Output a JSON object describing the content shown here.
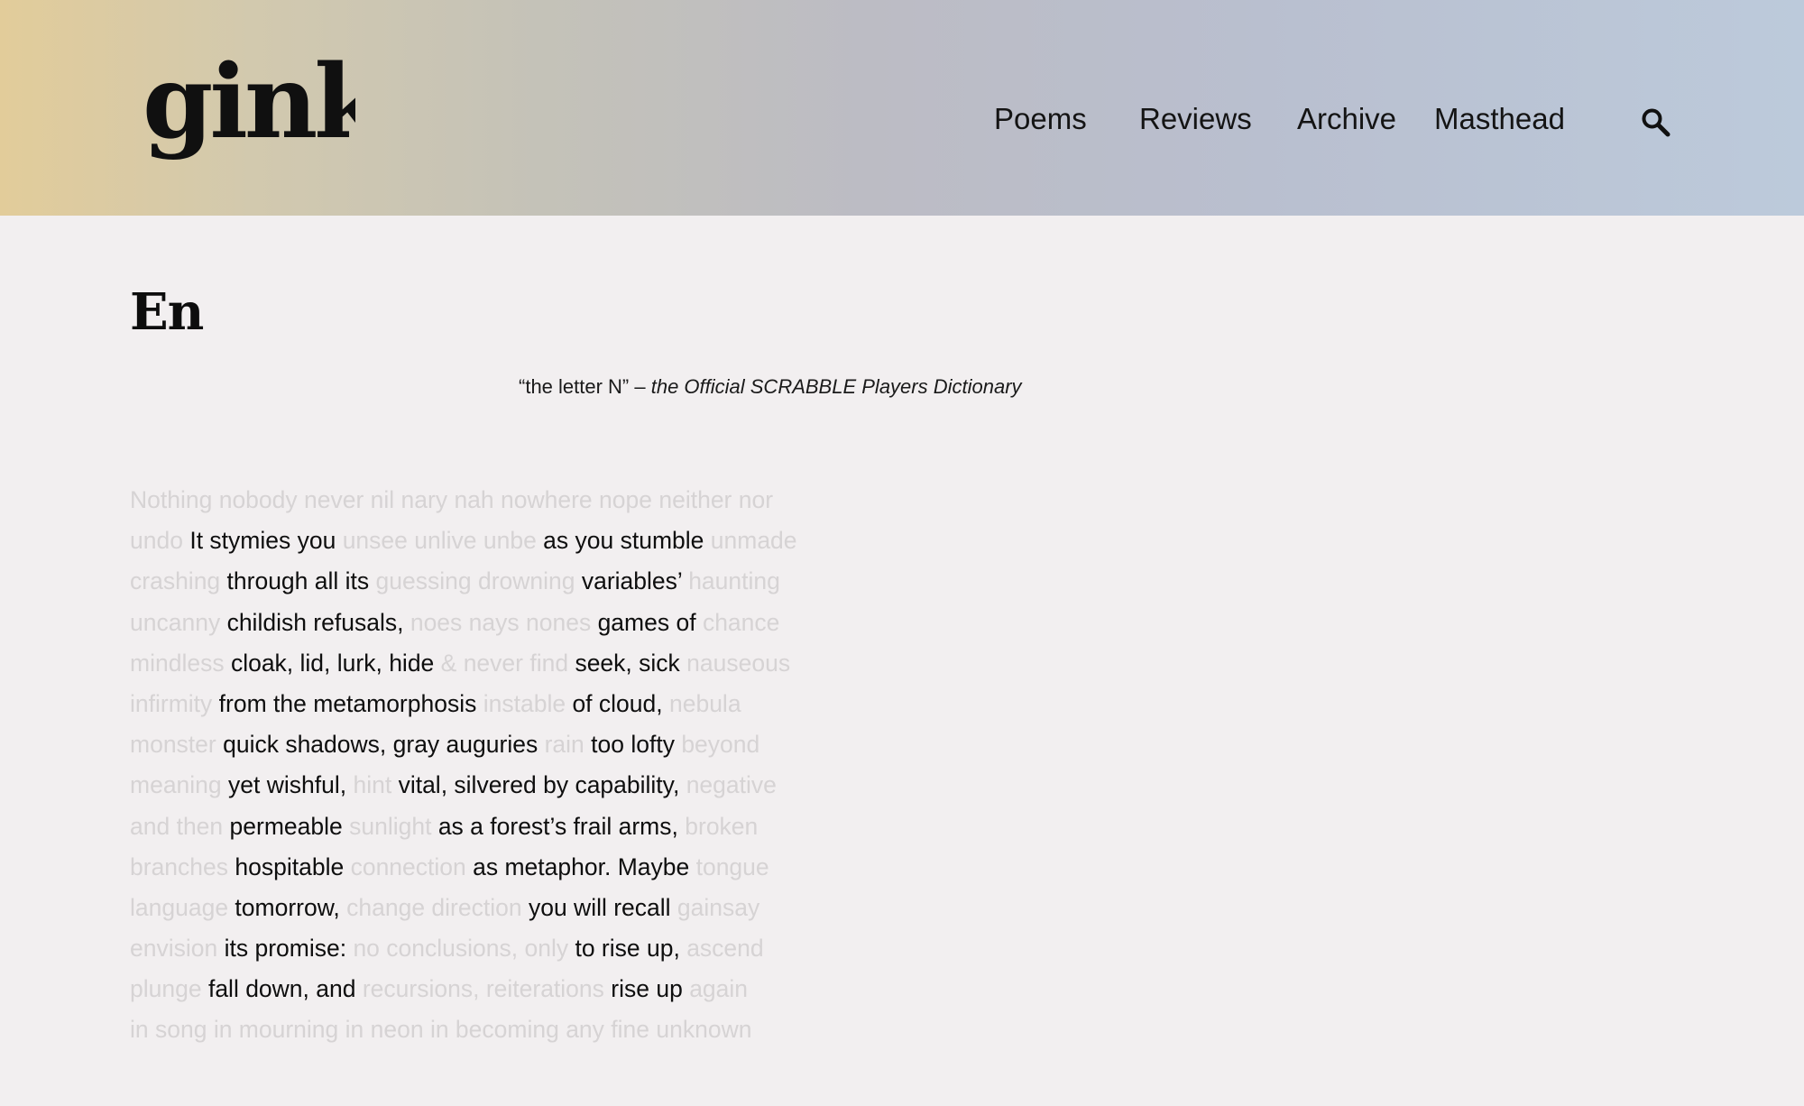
{
  "site": {
    "logo_text": "gink"
  },
  "nav": {
    "items": [
      {
        "label": "Poems"
      },
      {
        "label": "Reviews"
      },
      {
        "label": "Archive"
      },
      {
        "label": "Masthead"
      }
    ],
    "search_icon": "search-icon"
  },
  "article": {
    "title": "En",
    "epigraph": {
      "quote": "“the letter N” – ",
      "source": "the Official SCRABBLE Players Dictionary"
    },
    "poem_lines": [
      [
        {
          "t": "Nothing nobody never nil nary nah nowhere nope neither nor",
          "dim": true
        }
      ],
      [
        {
          "t": "undo ",
          "dim": true
        },
        {
          "t": "It stymies you ",
          "dim": false
        },
        {
          "t": "unsee unlive unbe ",
          "dim": true
        },
        {
          "t": "as you stumble ",
          "dim": false
        },
        {
          "t": "unmade",
          "dim": true
        }
      ],
      [
        {
          "t": "crashing ",
          "dim": true
        },
        {
          "t": "through all its ",
          "dim": false
        },
        {
          "t": "guessing drowning ",
          "dim": true
        },
        {
          "t": "variables’ ",
          "dim": false
        },
        {
          "t": "haunting",
          "dim": true
        }
      ],
      [
        {
          "t": "uncanny ",
          "dim": true
        },
        {
          "t": "childish refusals, ",
          "dim": false
        },
        {
          "t": "noes nays nones ",
          "dim": true
        },
        {
          "t": "games of ",
          "dim": false
        },
        {
          "t": "chance",
          "dim": true
        }
      ],
      [
        {
          "t": "mindless ",
          "dim": true
        },
        {
          "t": "cloak, lid, lurk, hide ",
          "dim": false
        },
        {
          "t": "& never find ",
          "dim": true
        },
        {
          "t": "seek, sick ",
          "dim": false
        },
        {
          "t": "nauseous",
          "dim": true
        }
      ],
      [
        {
          "t": "infirmity ",
          "dim": true
        },
        {
          "t": "from the metamorphosis ",
          "dim": false
        },
        {
          "t": "instable ",
          "dim": true
        },
        {
          "t": "of cloud, ",
          "dim": false
        },
        {
          "t": "nebula",
          "dim": true
        }
      ],
      [
        {
          "t": "monster ",
          "dim": true
        },
        {
          "t": "quick shadows, gray auguries ",
          "dim": false
        },
        {
          "t": "rain ",
          "dim": true
        },
        {
          "t": "too lofty ",
          "dim": false
        },
        {
          "t": "beyond",
          "dim": true
        }
      ],
      [
        {
          "t": "meaning ",
          "dim": true
        },
        {
          "t": "yet wishful, ",
          "dim": false
        },
        {
          "t": "hint ",
          "dim": true
        },
        {
          "t": "vital, silvered by capability, ",
          "dim": false
        },
        {
          "t": "negative",
          "dim": true
        }
      ],
      [
        {
          "t": "and then ",
          "dim": true
        },
        {
          "t": "permeable ",
          "dim": false
        },
        {
          "t": "sunlight ",
          "dim": true
        },
        {
          "t": "as a forest’s frail arms, ",
          "dim": false
        },
        {
          "t": "broken",
          "dim": true
        }
      ],
      [
        {
          "t": "branches ",
          "dim": true
        },
        {
          "t": "hospitable ",
          "dim": false
        },
        {
          "t": "connection ",
          "dim": true
        },
        {
          "t": "as metaphor. Maybe ",
          "dim": false
        },
        {
          "t": "tongue",
          "dim": true
        }
      ],
      [
        {
          "t": "language ",
          "dim": true
        },
        {
          "t": "tomorrow, ",
          "dim": false
        },
        {
          "t": "change direction ",
          "dim": true
        },
        {
          "t": "you will recall ",
          "dim": false
        },
        {
          "t": "gainsay",
          "dim": true
        }
      ],
      [
        {
          "t": "envision ",
          "dim": true
        },
        {
          "t": "its promise: ",
          "dim": false
        },
        {
          "t": "no conclusions, only ",
          "dim": true
        },
        {
          "t": "to rise up, ",
          "dim": false
        },
        {
          "t": "ascend",
          "dim": true
        }
      ],
      [
        {
          "t": "plunge ",
          "dim": true
        },
        {
          "t": "fall down, and ",
          "dim": false
        },
        {
          "t": "recursions, reiterations ",
          "dim": true
        },
        {
          "t": "rise up ",
          "dim": false
        },
        {
          "t": "again",
          "dim": true
        }
      ],
      [
        {
          "t": "in song in mourning in neon in becoming any fine unknown",
          "dim": true
        }
      ]
    ]
  }
}
